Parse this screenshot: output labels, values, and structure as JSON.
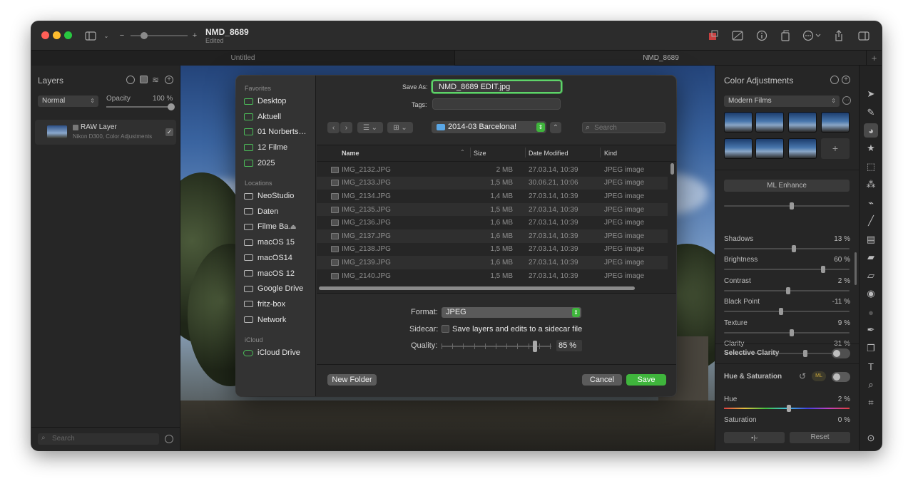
{
  "window": {
    "title": "NMD_8689",
    "subtitle": "Edited"
  },
  "tabs": [
    {
      "label": "Untitled"
    },
    {
      "label": "NMD_8689"
    }
  ],
  "layers_panel": {
    "title": "Layers",
    "blend_mode": "Normal",
    "opacity_label": "Opacity",
    "opacity_value": "100 %",
    "layer": {
      "name": "RAW Layer",
      "detail": "Nikon D300, Color Adjustments"
    },
    "search_placeholder": "Search"
  },
  "save_dialog": {
    "save_as_label": "Save As:",
    "save_as_value": "NMD_8689 EDIT.jpg",
    "tags_label": "Tags:",
    "location": "2014-03 Barcelona!",
    "search_placeholder": "Search",
    "sidebar": {
      "favorites_header": "Favorites",
      "favorites": [
        "Desktop",
        "Aktuell",
        "01 Norberts…",
        "12 Filme",
        "2025"
      ],
      "locations_header": "Locations",
      "locations": [
        "NeoStudio",
        "Daten",
        "Filme Ba…",
        "macOS 15",
        "macOS14",
        "macOS 12",
        "Google Drive",
        "fritz-box",
        "Network"
      ],
      "icloud_header": "iCloud",
      "icloud": [
        "iCloud Drive"
      ]
    },
    "columns": {
      "name": "Name",
      "size": "Size",
      "date": "Date Modified",
      "kind": "Kind"
    },
    "files": [
      {
        "name": "IMG_2132.JPG",
        "size": "2 MB",
        "date": "27.03.14, 10:39",
        "kind": "JPEG image"
      },
      {
        "name": "IMG_2133.JPG",
        "size": "1,5 MB",
        "date": "30.06.21, 10:06",
        "kind": "JPEG image"
      },
      {
        "name": "IMG_2134.JPG",
        "size": "1,4 MB",
        "date": "27.03.14, 10:39",
        "kind": "JPEG image"
      },
      {
        "name": "IMG_2135.JPG",
        "size": "1,5 MB",
        "date": "27.03.14, 10:39",
        "kind": "JPEG image"
      },
      {
        "name": "IMG_2136.JPG",
        "size": "1,6 MB",
        "date": "27.03.14, 10:39",
        "kind": "JPEG image"
      },
      {
        "name": "IMG_2137.JPG",
        "size": "1,6 MB",
        "date": "27.03.14, 10:39",
        "kind": "JPEG image"
      },
      {
        "name": "IMG_2138.JPG",
        "size": "1,5 MB",
        "date": "27.03.14, 10:39",
        "kind": "JPEG image"
      },
      {
        "name": "IMG_2139.JPG",
        "size": "1,6 MB",
        "date": "27.03.14, 10:39",
        "kind": "JPEG image"
      },
      {
        "name": "IMG_2140.JPG",
        "size": "1,5 MB",
        "date": "27.03.14, 10:39",
        "kind": "JPEG image"
      }
    ],
    "format_label": "Format:",
    "format_value": "JPEG",
    "sidecar_label": "Sidecar:",
    "sidecar_option": "Save layers and edits to a sidecar file",
    "quality_label": "Quality:",
    "quality_value": "85 %",
    "quality_fraction": 0.85,
    "new_folder": "New Folder",
    "cancel": "Cancel",
    "save": "Save"
  },
  "adjustments": {
    "title": "Color Adjustments",
    "preset": "Modern Films",
    "ml_enhance": "ML Enhance",
    "sliders": [
      {
        "label": "Shadows",
        "value": "13 %",
        "level": 0.56
      },
      {
        "label": "Brightness",
        "value": "60 %",
        "level": 0.8
      },
      {
        "label": "Contrast",
        "value": "2 %",
        "level": 0.51
      },
      {
        "label": "Black Point",
        "value": "-11 %",
        "level": 0.45
      },
      {
        "label": "Texture",
        "value": "9 %",
        "level": 0.54
      },
      {
        "label": "Clarity",
        "value": "31 %",
        "level": 0.65
      }
    ],
    "selective_clarity": "Selective Clarity",
    "hue_saturation": "Hue & Saturation",
    "ml_badge": "ML",
    "hue_label": "Hue",
    "hue_value": "2 %",
    "saturation_label": "Saturation",
    "saturation_value": "0 %",
    "reset": "Reset"
  },
  "colors": {
    "accent_green": "#3fb53c",
    "focus_green": "#5fd36a",
    "folder_green": "#4cbc58"
  }
}
